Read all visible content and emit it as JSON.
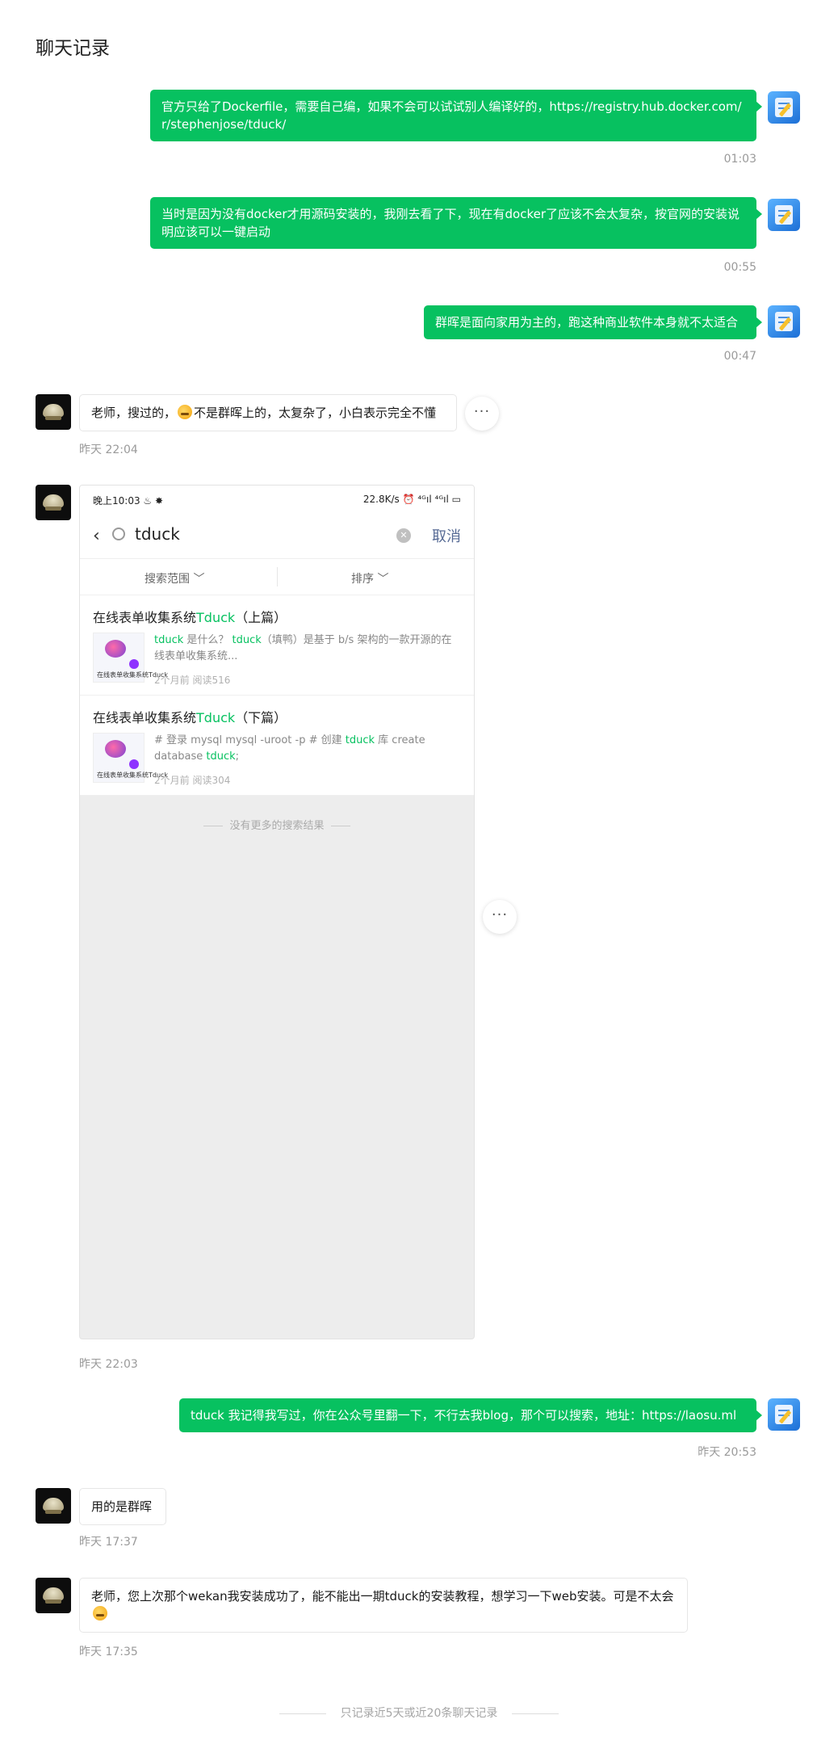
{
  "header": {
    "title": "聊天记录"
  },
  "messages": [
    {
      "text": "官方只给了Dockerfile，需要自己编，如果不会可以试试别人编译好的，https://registry.hub.docker.com/r/stephenjose/tduck/",
      "time": "01:03"
    },
    {
      "text": "当时是因为没有docker才用源码安装的，我刚去看了下，现在有docker了应该不会太复杂，按官网的安装说明应该可以一键启动",
      "time": "00:55"
    },
    {
      "text": "群晖是面向家用为主的，跑这种商业软件本身就不太适合",
      "time": "00:47"
    },
    {
      "text_before": "老师，搜过的，",
      "text_after": "不是群晖上的，太复杂了，小白表示完全不懂",
      "time": "昨天 22:04"
    },
    {
      "time": "昨天 22:03"
    },
    {
      "text": "tduck 我记得我写过，你在公众号里翻一下，不行去我blog，那个可以搜索，地址：https://laosu.ml",
      "time": "昨天 20:53"
    },
    {
      "text": "用的是群晖",
      "time": "昨天 17:37"
    },
    {
      "text_before": "老师，您上次那个wekan我安装成功了，能不能出一期tduck的安装教程，想学习一下web安装。可是不太会",
      "time": "昨天 17:35"
    }
  ],
  "screenshot": {
    "status_left": "晚上10:03 ♨ ✸",
    "status_right": "22.8K/s ⏰ ⁴ᴳıl ⁴ᴳıl ▭",
    "query": "tduck",
    "cancel": "取消",
    "filter_scope": "搜索范围 ﹀",
    "filter_sort": "排序 ﹀",
    "results": [
      {
        "title_prefix": "在线表单收集系统",
        "title_hl": "Tduck",
        "title_suffix": "（上篇）",
        "desc_hl1": "tduck",
        "desc_mid": " 是什么？ ",
        "desc_hl2": "tduck",
        "desc_tail": "（填鸭）是基于 b/s 架构的一款开源的在线表单收集系统...",
        "meta": "2个月前  阅读516",
        "thumb_text": "在线表单收集系统Tduck"
      },
      {
        "title_prefix": "在线表单收集系统",
        "title_hl": "Tduck",
        "title_suffix": "（下篇）",
        "desc_a": "# 登录 mysql mysql -uroot -p # 创建 ",
        "desc_hl1": "tduck",
        "desc_b": " 库 create database ",
        "desc_hl2": "tduck",
        "desc_c": ";",
        "meta": "2个月前  阅读304",
        "thumb_text": "在线表单收集系统Tduck"
      }
    ],
    "no_more": "没有更多的搜索结果"
  },
  "more_label": "···",
  "footer": {
    "text": "只记录近5天或近20条聊天记录"
  }
}
